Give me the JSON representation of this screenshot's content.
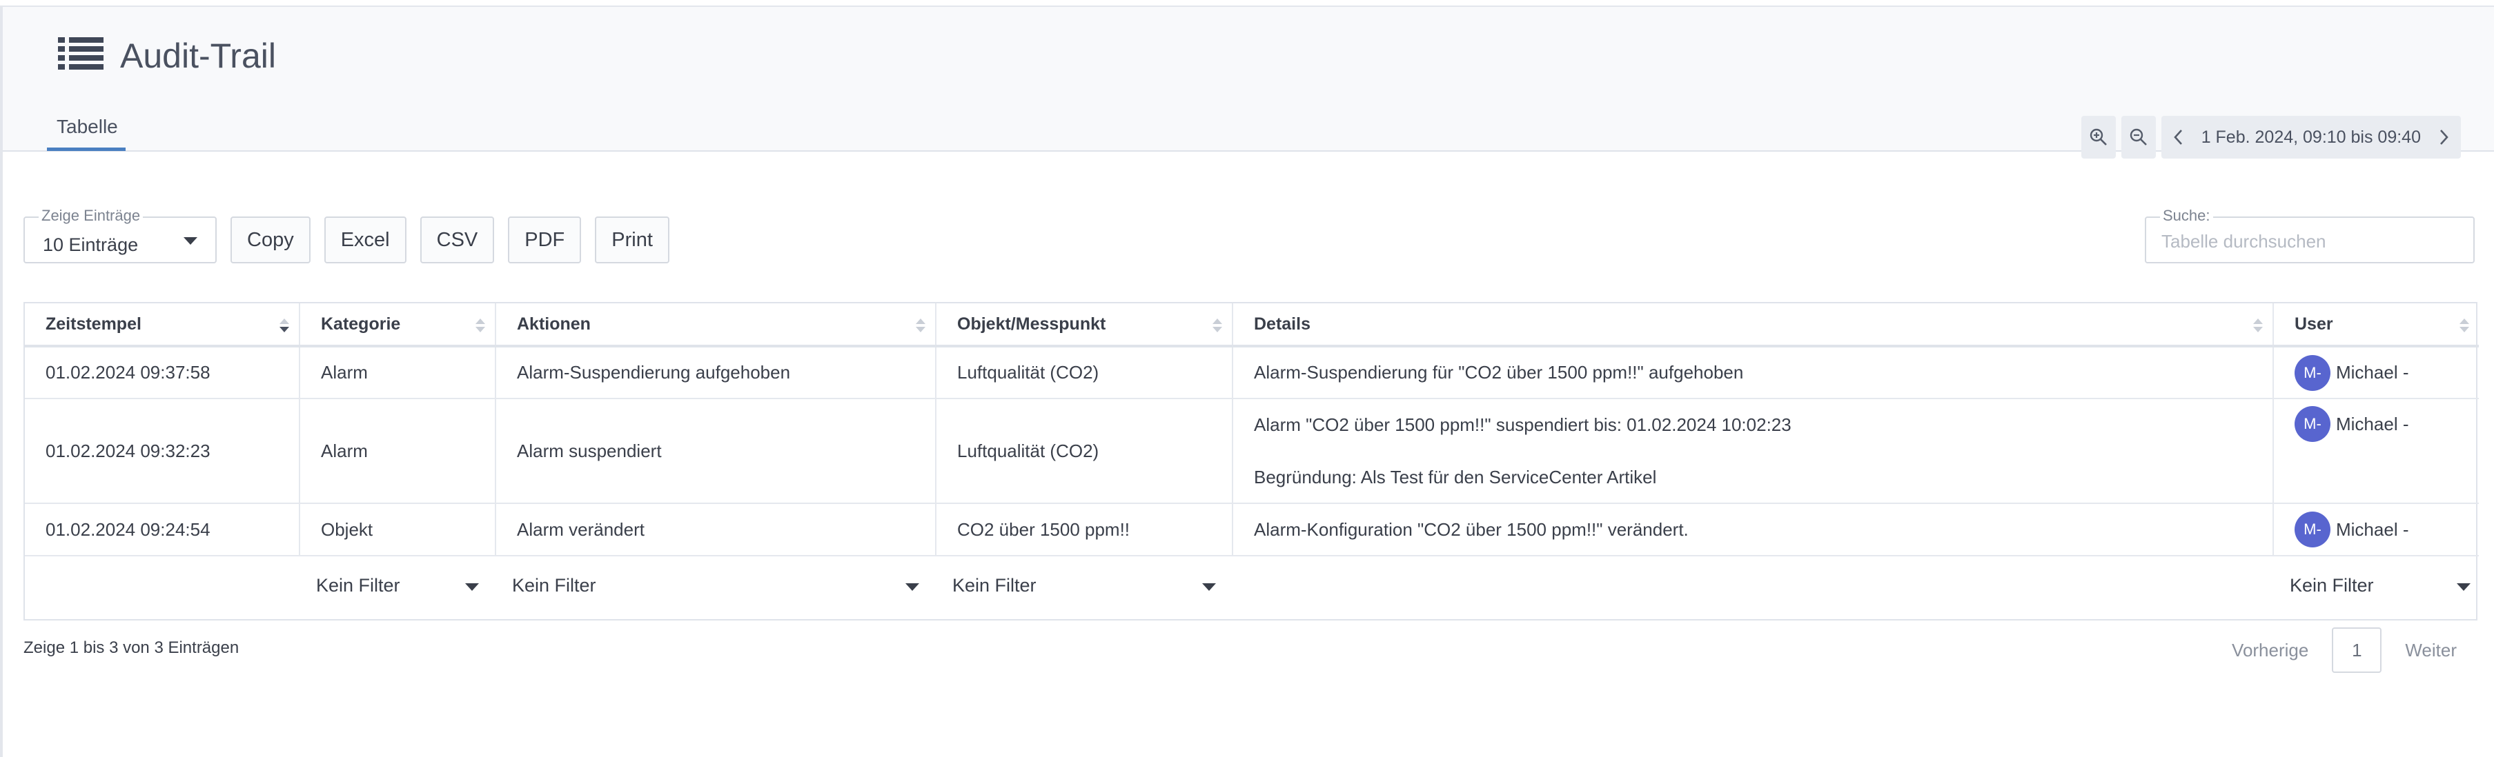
{
  "header": {
    "title": "Audit-Trail",
    "icon": "list-icon",
    "tab_label": "Tabelle"
  },
  "time_range": {
    "label": "1 Feb. 2024, 09:10 bis 09:40"
  },
  "controls": {
    "entries_legend": "Zeige Einträge",
    "entries_value": "10 Einträge",
    "buttons": [
      "Copy",
      "Excel",
      "CSV",
      "PDF",
      "Print"
    ],
    "search_legend": "Suche:",
    "search_placeholder": "Tabelle durchsuchen"
  },
  "table": {
    "columns": [
      "Zeitstempel",
      "Kategorie",
      "Aktionen",
      "Objekt/Messpunkt",
      "Details",
      "User"
    ],
    "rows": [
      {
        "timestamp": "01.02.2024 09:37:58",
        "category": "Alarm",
        "action": "Alarm-Suspendierung aufgehoben",
        "object": "Luftqualität (CO2)",
        "details": [
          "Alarm-Suspendierung für \"CO2 über 1500 ppm!!\" aufgehoben"
        ],
        "user_initials": "M-",
        "user": "Michael -"
      },
      {
        "timestamp": "01.02.2024 09:32:23",
        "category": "Alarm",
        "action": "Alarm suspendiert",
        "object": "Luftqualität (CO2)",
        "details": [
          "Alarm \"CO2 über 1500 ppm!!\" suspendiert bis: 01.02.2024 10:02:23",
          "Begründung: Als Test für den ServiceCenter Artikel"
        ],
        "user_initials": "M-",
        "user": "Michael -"
      },
      {
        "timestamp": "01.02.2024 09:24:54",
        "category": "Objekt",
        "action": "Alarm verändert",
        "object": "CO2 über 1500 ppm!!",
        "details": [
          "Alarm-Konfiguration \"CO2 über 1500 ppm!!\" verändert."
        ],
        "user_initials": "M-",
        "user": "Michael -"
      }
    ],
    "filter_label": "Kein Filter"
  },
  "footer": {
    "info": "Zeige 1 bis 3 von 3 Einträgen",
    "prev": "Vorherige",
    "page": "1",
    "next": "Weiter"
  },
  "colors": {
    "accent": "#4a7fc1",
    "avatar": "#5865cf"
  }
}
